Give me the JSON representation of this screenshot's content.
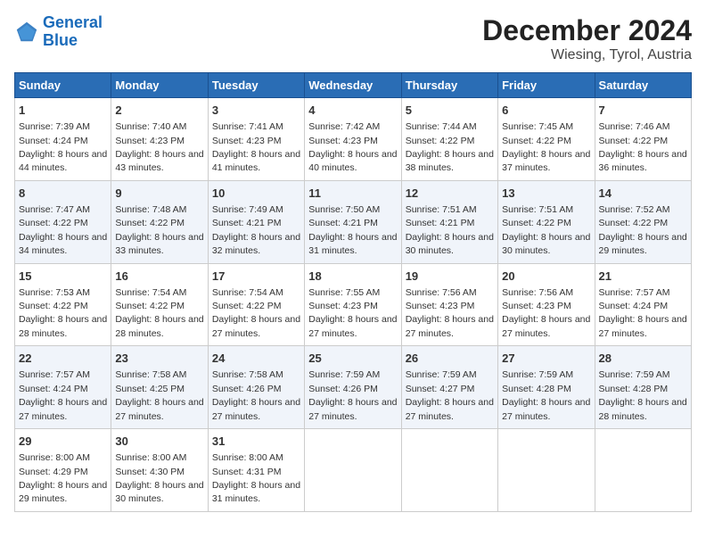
{
  "logo": {
    "line1": "General",
    "line2": "Blue"
  },
  "title": "December 2024",
  "subtitle": "Wiesing, Tyrol, Austria",
  "headers": [
    "Sunday",
    "Monday",
    "Tuesday",
    "Wednesday",
    "Thursday",
    "Friday",
    "Saturday"
  ],
  "weeks": [
    [
      {
        "day": "1",
        "sunrise": "Sunrise: 7:39 AM",
        "sunset": "Sunset: 4:24 PM",
        "daylight": "Daylight: 8 hours and 44 minutes."
      },
      {
        "day": "2",
        "sunrise": "Sunrise: 7:40 AM",
        "sunset": "Sunset: 4:23 PM",
        "daylight": "Daylight: 8 hours and 43 minutes."
      },
      {
        "day": "3",
        "sunrise": "Sunrise: 7:41 AM",
        "sunset": "Sunset: 4:23 PM",
        "daylight": "Daylight: 8 hours and 41 minutes."
      },
      {
        "day": "4",
        "sunrise": "Sunrise: 7:42 AM",
        "sunset": "Sunset: 4:23 PM",
        "daylight": "Daylight: 8 hours and 40 minutes."
      },
      {
        "day": "5",
        "sunrise": "Sunrise: 7:44 AM",
        "sunset": "Sunset: 4:22 PM",
        "daylight": "Daylight: 8 hours and 38 minutes."
      },
      {
        "day": "6",
        "sunrise": "Sunrise: 7:45 AM",
        "sunset": "Sunset: 4:22 PM",
        "daylight": "Daylight: 8 hours and 37 minutes."
      },
      {
        "day": "7",
        "sunrise": "Sunrise: 7:46 AM",
        "sunset": "Sunset: 4:22 PM",
        "daylight": "Daylight: 8 hours and 36 minutes."
      }
    ],
    [
      {
        "day": "8",
        "sunrise": "Sunrise: 7:47 AM",
        "sunset": "Sunset: 4:22 PM",
        "daylight": "Daylight: 8 hours and 34 minutes."
      },
      {
        "day": "9",
        "sunrise": "Sunrise: 7:48 AM",
        "sunset": "Sunset: 4:22 PM",
        "daylight": "Daylight: 8 hours and 33 minutes."
      },
      {
        "day": "10",
        "sunrise": "Sunrise: 7:49 AM",
        "sunset": "Sunset: 4:21 PM",
        "daylight": "Daylight: 8 hours and 32 minutes."
      },
      {
        "day": "11",
        "sunrise": "Sunrise: 7:50 AM",
        "sunset": "Sunset: 4:21 PM",
        "daylight": "Daylight: 8 hours and 31 minutes."
      },
      {
        "day": "12",
        "sunrise": "Sunrise: 7:51 AM",
        "sunset": "Sunset: 4:21 PM",
        "daylight": "Daylight: 8 hours and 30 minutes."
      },
      {
        "day": "13",
        "sunrise": "Sunrise: 7:51 AM",
        "sunset": "Sunset: 4:22 PM",
        "daylight": "Daylight: 8 hours and 30 minutes."
      },
      {
        "day": "14",
        "sunrise": "Sunrise: 7:52 AM",
        "sunset": "Sunset: 4:22 PM",
        "daylight": "Daylight: 8 hours and 29 minutes."
      }
    ],
    [
      {
        "day": "15",
        "sunrise": "Sunrise: 7:53 AM",
        "sunset": "Sunset: 4:22 PM",
        "daylight": "Daylight: 8 hours and 28 minutes."
      },
      {
        "day": "16",
        "sunrise": "Sunrise: 7:54 AM",
        "sunset": "Sunset: 4:22 PM",
        "daylight": "Daylight: 8 hours and 28 minutes."
      },
      {
        "day": "17",
        "sunrise": "Sunrise: 7:54 AM",
        "sunset": "Sunset: 4:22 PM",
        "daylight": "Daylight: 8 hours and 27 minutes."
      },
      {
        "day": "18",
        "sunrise": "Sunrise: 7:55 AM",
        "sunset": "Sunset: 4:23 PM",
        "daylight": "Daylight: 8 hours and 27 minutes."
      },
      {
        "day": "19",
        "sunrise": "Sunrise: 7:56 AM",
        "sunset": "Sunset: 4:23 PM",
        "daylight": "Daylight: 8 hours and 27 minutes."
      },
      {
        "day": "20",
        "sunrise": "Sunrise: 7:56 AM",
        "sunset": "Sunset: 4:23 PM",
        "daylight": "Daylight: 8 hours and 27 minutes."
      },
      {
        "day": "21",
        "sunrise": "Sunrise: 7:57 AM",
        "sunset": "Sunset: 4:24 PM",
        "daylight": "Daylight: 8 hours and 27 minutes."
      }
    ],
    [
      {
        "day": "22",
        "sunrise": "Sunrise: 7:57 AM",
        "sunset": "Sunset: 4:24 PM",
        "daylight": "Daylight: 8 hours and 27 minutes."
      },
      {
        "day": "23",
        "sunrise": "Sunrise: 7:58 AM",
        "sunset": "Sunset: 4:25 PM",
        "daylight": "Daylight: 8 hours and 27 minutes."
      },
      {
        "day": "24",
        "sunrise": "Sunrise: 7:58 AM",
        "sunset": "Sunset: 4:26 PM",
        "daylight": "Daylight: 8 hours and 27 minutes."
      },
      {
        "day": "25",
        "sunrise": "Sunrise: 7:59 AM",
        "sunset": "Sunset: 4:26 PM",
        "daylight": "Daylight: 8 hours and 27 minutes."
      },
      {
        "day": "26",
        "sunrise": "Sunrise: 7:59 AM",
        "sunset": "Sunset: 4:27 PM",
        "daylight": "Daylight: 8 hours and 27 minutes."
      },
      {
        "day": "27",
        "sunrise": "Sunrise: 7:59 AM",
        "sunset": "Sunset: 4:28 PM",
        "daylight": "Daylight: 8 hours and 27 minutes."
      },
      {
        "day": "28",
        "sunrise": "Sunrise: 7:59 AM",
        "sunset": "Sunset: 4:28 PM",
        "daylight": "Daylight: 8 hours and 28 minutes."
      }
    ],
    [
      {
        "day": "29",
        "sunrise": "Sunrise: 8:00 AM",
        "sunset": "Sunset: 4:29 PM",
        "daylight": "Daylight: 8 hours and 29 minutes."
      },
      {
        "day": "30",
        "sunrise": "Sunrise: 8:00 AM",
        "sunset": "Sunset: 4:30 PM",
        "daylight": "Daylight: 8 hours and 30 minutes."
      },
      {
        "day": "31",
        "sunrise": "Sunrise: 8:00 AM",
        "sunset": "Sunset: 4:31 PM",
        "daylight": "Daylight: 8 hours and 31 minutes."
      },
      null,
      null,
      null,
      null
    ]
  ]
}
